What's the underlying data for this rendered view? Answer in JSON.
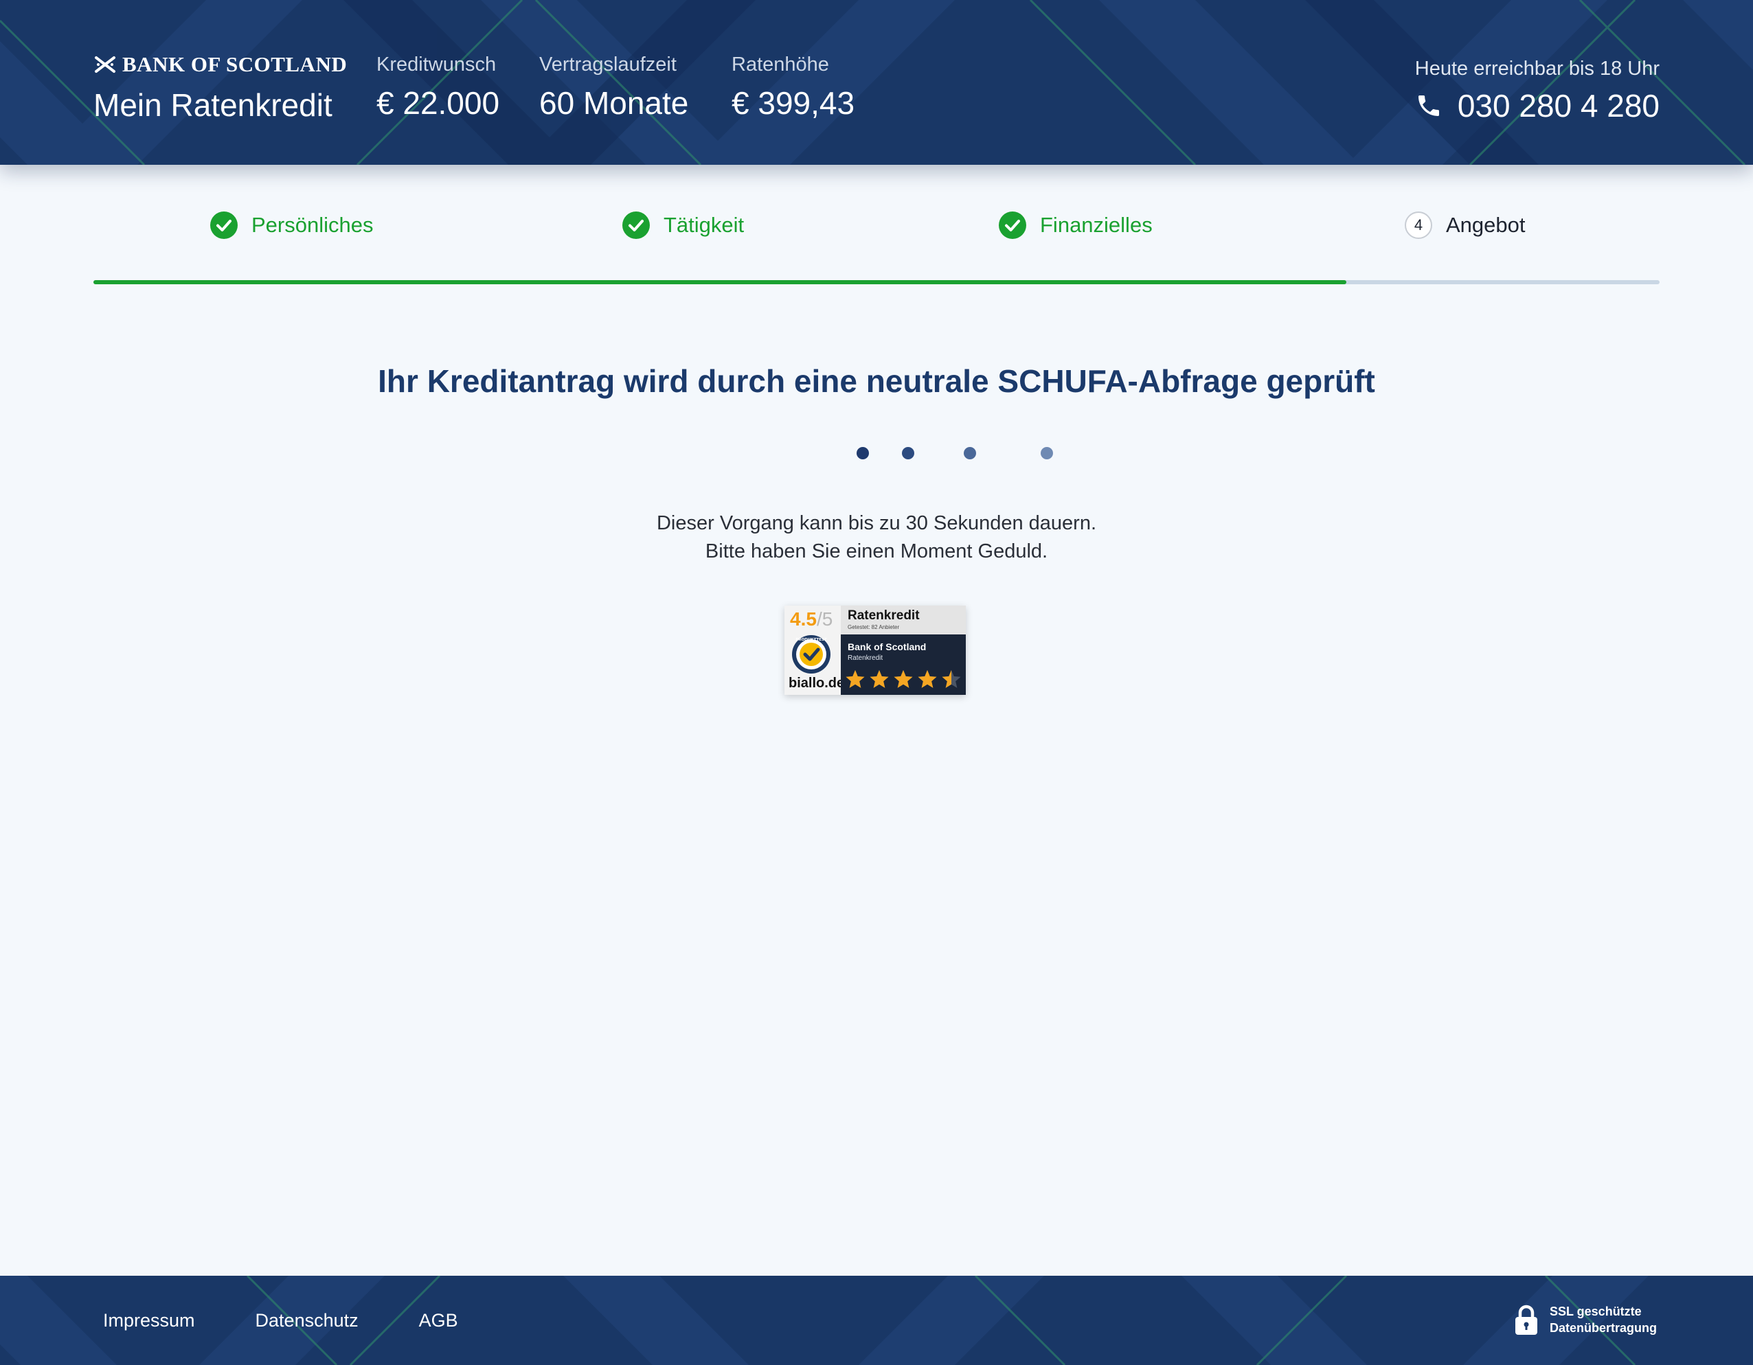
{
  "header": {
    "logo_text": "BANK OF SCOTLAND",
    "product_title": "Mein Ratenkredit",
    "stats": [
      {
        "label": "Kreditwunsch",
        "value": "€ 22.000"
      },
      {
        "label": "Vertragslaufzeit",
        "value": "60 Monate"
      },
      {
        "label": "Ratenhöhe",
        "value": "€ 399,43"
      }
    ],
    "contact": {
      "hours": "Heute erreichbar bis 18 Uhr",
      "phone": "030 280 4 280",
      "phone_icon": "phone-icon"
    }
  },
  "stepper": {
    "steps": [
      {
        "label": "Persönliches",
        "status": "done",
        "icon": "check-circle-icon"
      },
      {
        "label": "Tätigkeit",
        "status": "done",
        "icon": "check-circle-icon"
      },
      {
        "label": "Finanzielles",
        "status": "done",
        "icon": "check-circle-icon"
      },
      {
        "label": "Angebot",
        "status": "current",
        "number": "4"
      }
    ],
    "progress": 0.8
  },
  "main": {
    "title": "Ihr Kreditantrag wird durch eine neutrale SCHUFA-Abfrage geprüft",
    "info_line1": "Dieser Vorgang kann bis zu 30 Sekunden dauern.",
    "info_line2": "Bitte haben Sie einen Moment Geduld."
  },
  "badge": {
    "score": "4.5",
    "score_max": "/5",
    "category": "Ratenkredit",
    "tested": "Getestet: 82 Anbieter",
    "bank": "Bank of Scotland",
    "product": "Ratenkredit",
    "site": "biallo.de",
    "seal_text": "PRODUKTTEST",
    "rating": 4.5
  },
  "footer": {
    "links": [
      "Impressum",
      "Datenschutz",
      "AGB"
    ],
    "ssl_line1": "SSL geschützte",
    "ssl_line2": "Datenübertragung",
    "ssl_icon": "lock-icon"
  },
  "colors": {
    "brand_navy": "#1b3a6b",
    "success_green": "#1aa130",
    "page_background": "#f4f8fc",
    "star_orange": "#f5a623"
  }
}
